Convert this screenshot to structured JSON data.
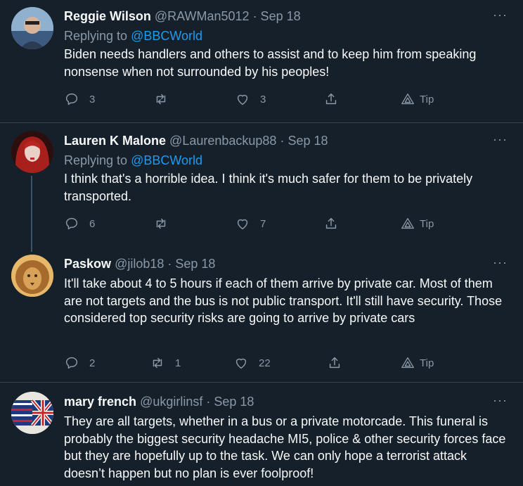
{
  "tweets": [
    {
      "name": "Reggie Wilson",
      "handle": "@RAWMan5012",
      "date": "· Sep 18",
      "replying_prefix": "Replying to ",
      "replying_to": "@BBCWorld",
      "text": "Biden needs handlers and others to assist and to keep him from speaking nonsense when not surrounded by his peoples!",
      "replies": "3",
      "retweets": "",
      "likes": "3",
      "tip": "Tip",
      "more": "···"
    },
    {
      "name": "Lauren K Malone",
      "handle": "@Laurenbackup88",
      "date": "· Sep 18",
      "replying_prefix": "Replying to ",
      "replying_to": "@BBCWorld",
      "text": "I think that's a horrible idea. I think it's much safer for them to be privately transported.",
      "replies": "6",
      "retweets": "",
      "likes": "7",
      "tip": "Tip",
      "more": "···"
    },
    {
      "name": "Paskow",
      "handle": "@jilob18",
      "date": "· Sep 18",
      "text": "It'll take about 4 to 5 hours if each of them arrive by private car. Most of them are not targets and the bus is not public transport. It'll still have security. Those considered top security risks are going to arrive by private cars",
      "replies": "2",
      "retweets": "1",
      "likes": "22",
      "tip": "Tip",
      "more": "···"
    },
    {
      "name": "mary french",
      "handle": "@ukgirlinsf",
      "date": "· Sep 18",
      "text": "They are all targets, whether in a bus or a private motorcade. This funeral is probably the biggest security headache MI5, police & other security forces face but they are hopefully up to the task. We can only hope a terrorist attack doesn’t happen but no plan is ever foolproof!",
      "more": "···"
    }
  ],
  "icons": {
    "reply": "reply-icon",
    "retweet": "retweet-icon",
    "like": "like-icon",
    "share": "share-icon",
    "tip": "tip-icon",
    "more": "more-icon"
  },
  "colors": {
    "background": "#15202b",
    "text": "#f7f9f9",
    "muted": "#8b98a5",
    "link": "#1d9bf0"
  }
}
